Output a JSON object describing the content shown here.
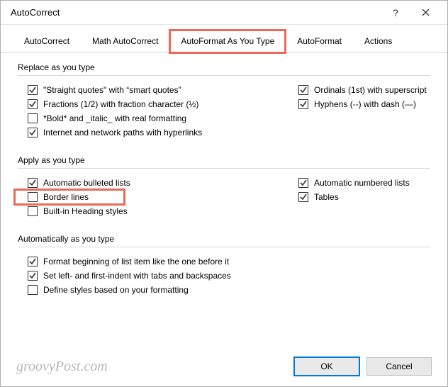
{
  "window": {
    "title": "AutoCorrect",
    "help_symbol": "?",
    "close_label": "Close"
  },
  "tabs": [
    {
      "label": "AutoCorrect",
      "active": false,
      "highlighted": false
    },
    {
      "label": "Math AutoCorrect",
      "active": false,
      "highlighted": false
    },
    {
      "label": "AutoFormat As You Type",
      "active": true,
      "highlighted": true
    },
    {
      "label": "AutoFormat",
      "active": false,
      "highlighted": false
    },
    {
      "label": "Actions",
      "active": false,
      "highlighted": false
    }
  ],
  "sections": {
    "replace": {
      "title": "Replace as you type",
      "left": [
        {
          "label": "\"Straight quotes\" with “smart quotes”",
          "checked": true
        },
        {
          "label": "Fractions (1/2) with fraction character (½)",
          "checked": true
        },
        {
          "label": "*Bold* and _italic_ with real formatting",
          "checked": false
        },
        {
          "label": "Internet and network paths with hyperlinks",
          "checked": true
        }
      ],
      "right": [
        {
          "label": "Ordinals (1st) with superscript",
          "checked": true
        },
        {
          "label": "Hyphens (--) with dash (—)",
          "checked": true
        }
      ]
    },
    "apply": {
      "title": "Apply as you type",
      "left": [
        {
          "label": "Automatic bulleted lists",
          "checked": true
        },
        {
          "label": "Border lines",
          "checked": false,
          "highlighted": true
        },
        {
          "label": "Built-in Heading styles",
          "checked": false
        }
      ],
      "right": [
        {
          "label": "Automatic numbered lists",
          "checked": true
        },
        {
          "label": "Tables",
          "checked": true
        }
      ]
    },
    "auto": {
      "title": "Automatically as you type",
      "items": [
        {
          "label": "Format beginning of list item like the one before it",
          "checked": true
        },
        {
          "label": "Set left- and first-indent with tabs and backspaces",
          "checked": true
        },
        {
          "label": "Define styles based on your formatting",
          "checked": false
        }
      ]
    }
  },
  "footer": {
    "watermark": "groovyPost.com",
    "ok": "OK",
    "cancel": "Cancel"
  }
}
